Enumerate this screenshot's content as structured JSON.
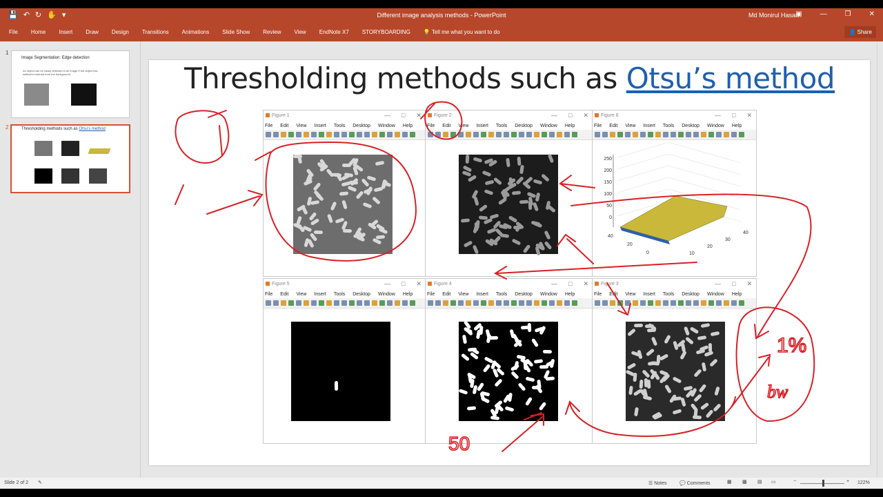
{
  "app": {
    "title": "Different image analysis methods - PowerPoint",
    "user": "Md Monirul Hasan",
    "share_label": "Share"
  },
  "ribbon": {
    "tabs": [
      "File",
      "Home",
      "Insert",
      "Draw",
      "Design",
      "Transitions",
      "Animations",
      "Slide Show",
      "Review",
      "View",
      "EndNote X7",
      "STORYBOARDING"
    ],
    "tell_me": "Tell me what you want to do"
  },
  "thumbnails": [
    {
      "num": "1",
      "title": "Image Segmentation: Edge detection",
      "text": "An object can be easily detected in an image if the object has sufficient contrast from the background."
    },
    {
      "num": "2",
      "title_plain": "Thresholding methods such as",
      "title_link": "Otsu's method"
    }
  ],
  "slide": {
    "title_plain": "Thresholding methods such as ",
    "title_link": "Otsu’s method"
  },
  "figures": {
    "menu": [
      "File",
      "Edit",
      "View",
      "Insert",
      "Tools",
      "Desktop",
      "Window",
      "Help"
    ],
    "items": [
      {
        "title": "Figure 1"
      },
      {
        "title": "Figure 2"
      },
      {
        "title": "Figure 6"
      },
      {
        "title": "Figure 5"
      },
      {
        "title": "Figure 4"
      },
      {
        "title": "Figure 3"
      }
    ]
  },
  "plot3d": {
    "z_ticks": [
      "250",
      "200",
      "150",
      "100",
      "50",
      "0"
    ],
    "y_ticks": [
      "40",
      "20",
      "0"
    ],
    "x_ticks": [
      "10",
      "20",
      "30",
      "40"
    ]
  },
  "annotations": {
    "num50": "50",
    "pct": "1%",
    "bw": "bw"
  },
  "status": {
    "slide": "Slide 2 of 2",
    "notes": "Notes",
    "comments": "Comments",
    "zoom": "122%"
  },
  "colors": {
    "accent": "#b7472a",
    "ink": "#d81f26",
    "link": "#1f5fae"
  }
}
